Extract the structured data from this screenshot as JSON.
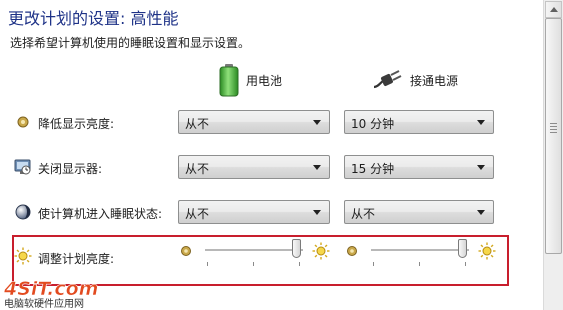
{
  "window": {
    "title": "更改计划的设置: 高性能",
    "subtitle": "选择希望计算机使用的睡眠设置和显示设置。"
  },
  "columns": {
    "battery": {
      "label": "用电池",
      "icon": "battery-icon"
    },
    "plugged": {
      "label": "接通电源",
      "icon": "power-plug-icon"
    }
  },
  "settings": [
    {
      "label": "降低显示亮度:",
      "icon": "dim-display-icon",
      "battery_value": "从不",
      "plugged_value": "10 分钟"
    },
    {
      "label": "关闭显示器:",
      "icon": "monitor-icon",
      "battery_value": "从不",
      "plugged_value": "15 分钟"
    },
    {
      "label": "使计算机进入睡眠状态:",
      "icon": "sleep-icon",
      "battery_value": "从不",
      "plugged_value": "从不"
    }
  ],
  "brightness": {
    "label": "调整计划亮度:",
    "battery_level": 0.93,
    "plugged_level": 0.93
  },
  "watermark": {
    "logo": "4SiT.com",
    "caption": "电脑软硬件应用网"
  },
  "colors": {
    "title": "#1e3287",
    "highlight_border": "#c81e2d",
    "battery_green": "#3cae2e"
  }
}
